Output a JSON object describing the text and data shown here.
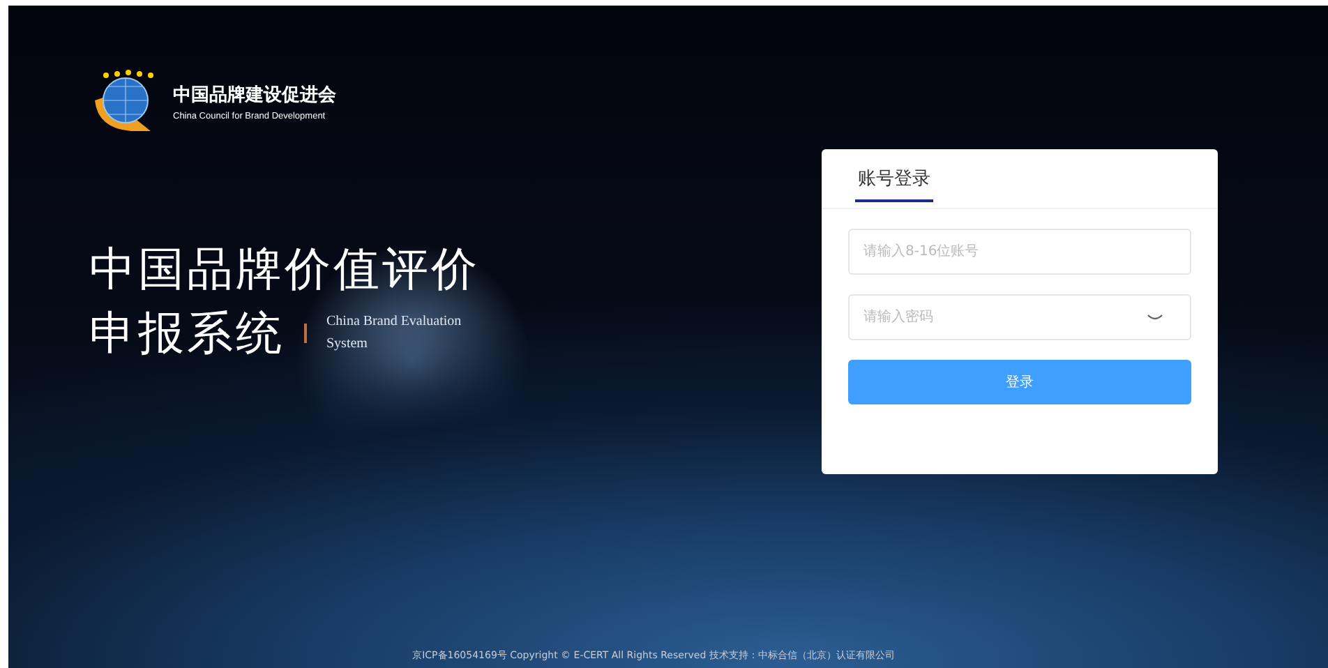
{
  "logo": {
    "name": "中国品牌建设促进会",
    "subtitle": "China Council for Brand Development"
  },
  "hero": {
    "title_line1": "中国品牌价值评价",
    "title_line2": "申报系统",
    "english": "China Brand Evaluation System"
  },
  "login": {
    "tabs": [
      {
        "label": "账号登录",
        "selected": true
      }
    ],
    "account": {
      "placeholder": "请输入8-16位账号"
    },
    "password": {
      "placeholder": "请输入密码"
    },
    "submit": "登录"
  },
  "footer": "京ICP备16054169号 Copyright © E-CERT All Rights Reserved 技术支持：中标合信（北京）认证有限公司"
}
